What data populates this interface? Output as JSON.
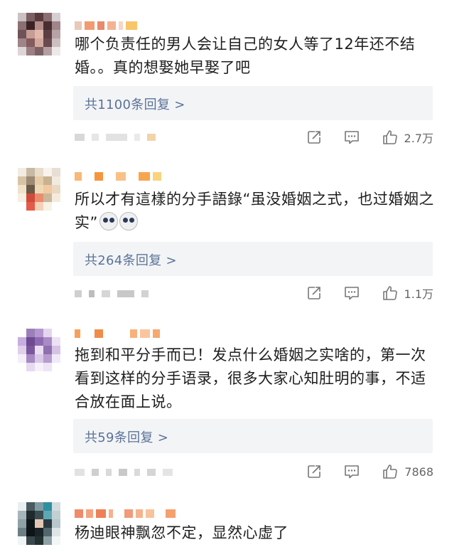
{
  "comments": [
    {
      "content": "哪个负责任的男人会让自己的女人等了12年还不结婚。。真的想娶她早娶了吧",
      "reply_label": "共1100条回复 >",
      "like_count": "2.7万"
    },
    {
      "content": "所以才有這樣的分手語錄“虽没婚姻之式，也过婚姻之实”",
      "reply_label": "共264条回复 >",
      "like_count": "1.1万"
    },
    {
      "content": "拖到和平分手而已！发点什么婚姻之实啥的，第一次看到这样的分手语录，很多大家心知肚明的事，不适合放在面上说。",
      "reply_label": "共59条回复 >",
      "like_count": "7868"
    },
    {
      "content": "杨迪眼神飘忽不定，显然心虚了"
    }
  ],
  "icons": {
    "share": "share-icon",
    "comment": "comment-icon",
    "like": "thumbs-up-icon"
  },
  "colors": {
    "reply_link": "#5b7397",
    "reply_bg": "#f3f4f6",
    "username_blur": "#f6a15a"
  }
}
